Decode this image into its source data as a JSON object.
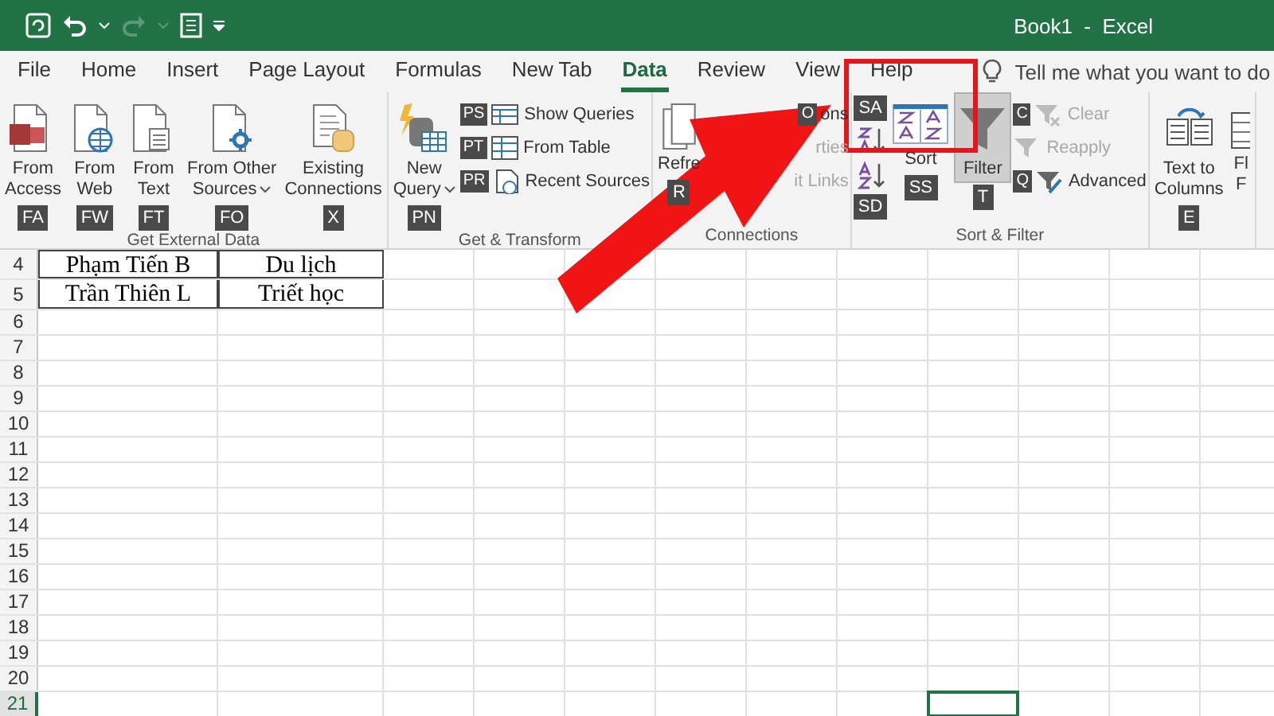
{
  "window": {
    "title": "Book1  -  Excel"
  },
  "tabs": [
    {
      "label": "File",
      "selected": false
    },
    {
      "label": "Home",
      "selected": false
    },
    {
      "label": "Insert",
      "selected": false
    },
    {
      "label": "Page Layout",
      "selected": false
    },
    {
      "label": "Formulas",
      "selected": false
    },
    {
      "label": "New Tab",
      "selected": false
    },
    {
      "label": "Data",
      "selected": true
    },
    {
      "label": "Review",
      "selected": false
    },
    {
      "label": "View",
      "selected": false
    },
    {
      "label": "Help",
      "selected": false
    }
  ],
  "tell_me": {
    "placeholder": "Tell me what you want to do"
  },
  "ribbon": [
    {
      "label": "Get External Data",
      "items": [
        {
          "kind": "large",
          "label": "From\nAccess",
          "keytip": "FA",
          "dropdown": false,
          "pressed": false
        },
        {
          "kind": "large",
          "label": "From\nWeb",
          "keytip": "FW",
          "dropdown": false,
          "pressed": false
        },
        {
          "kind": "large",
          "label": "From\nText",
          "keytip": "FT",
          "dropdown": false,
          "pressed": false
        },
        {
          "kind": "large",
          "label": "From Other\nSources",
          "keytip": "FO",
          "dropdown": true,
          "pressed": false
        },
        {
          "kind": "large",
          "label": "Existing\nConnections",
          "keytip": "X",
          "dropdown": false,
          "pressed": false
        }
      ]
    },
    {
      "label": "Get & Transform",
      "items": [
        {
          "kind": "large",
          "label": "New\nQuery",
          "keytip": "PN",
          "dropdown": true,
          "pressed": false
        },
        {
          "kind": "stack",
          "children": [
            {
              "label": "Show Queries",
              "keytip": "PS",
              "disabled": false
            },
            {
              "label": "From Table",
              "keytip": "PT",
              "disabled": false
            },
            {
              "label": "Recent Sources",
              "keytip": "PR",
              "disabled": false
            }
          ]
        }
      ]
    },
    {
      "label": "Connections",
      "items": [
        {
          "kind": "large",
          "label": "Refre",
          "keytip": "R",
          "dropdown": false,
          "pressed": false
        },
        {
          "kind": "stack",
          "children": [
            {
              "label": "ons",
              "keytip": "O",
              "disabled": false
            },
            {
              "label": "rties",
              "disabled": true
            },
            {
              "label": "it Links",
              "disabled": true
            }
          ]
        }
      ]
    },
    {
      "label": "Sort & Filter",
      "items": [
        {
          "kind": "sortpair",
          "children": [
            {
              "keytip": "SA"
            },
            {
              "keytip": "SD"
            }
          ]
        },
        {
          "kind": "large",
          "label": "Sort",
          "keytip": "SS",
          "dropdown": false,
          "pressed": false
        },
        {
          "kind": "large",
          "label": "Filter",
          "keytip": "T",
          "dropdown": false,
          "pressed": true
        },
        {
          "kind": "stack",
          "children": [
            {
              "label": "Clear",
              "keytip": "C",
              "disabled": true
            },
            {
              "label": "Reapply",
              "disabled": true
            },
            {
              "label": "Advanced",
              "keytip": "Q",
              "disabled": false
            }
          ]
        }
      ]
    },
    {
      "items": [
        {
          "kind": "large",
          "label": "Text to\nColumns",
          "keytip": "E",
          "dropdown": false,
          "pressed": false
        },
        {
          "kind": "large",
          "label": "Fl\nF",
          "dropdown": false,
          "pressed": false
        }
      ]
    }
  ],
  "sheet": {
    "rows": [
      {
        "header": "4",
        "cells": [
          "Phạm Tiến B",
          "Du lịch"
        ],
        "selected": false
      },
      {
        "header": "5",
        "cells": [
          "Trần Thiên L",
          "Triết học"
        ],
        "selected": false
      },
      {
        "header": "6",
        "selected": false
      },
      {
        "header": "7",
        "selected": false
      },
      {
        "header": "8",
        "selected": false
      },
      {
        "header": "9",
        "selected": false
      },
      {
        "header": "10",
        "selected": false
      },
      {
        "header": "11",
        "selected": false
      },
      {
        "header": "12",
        "selected": false
      },
      {
        "header": "13",
        "selected": false
      },
      {
        "header": "14",
        "selected": false
      },
      {
        "header": "15",
        "selected": false
      },
      {
        "header": "16",
        "selected": false
      },
      {
        "header": "17",
        "selected": false
      },
      {
        "header": "18",
        "selected": false
      },
      {
        "header": "19",
        "selected": false
      },
      {
        "header": "20",
        "selected": false
      },
      {
        "header": "21",
        "selected": true
      }
    ]
  }
}
